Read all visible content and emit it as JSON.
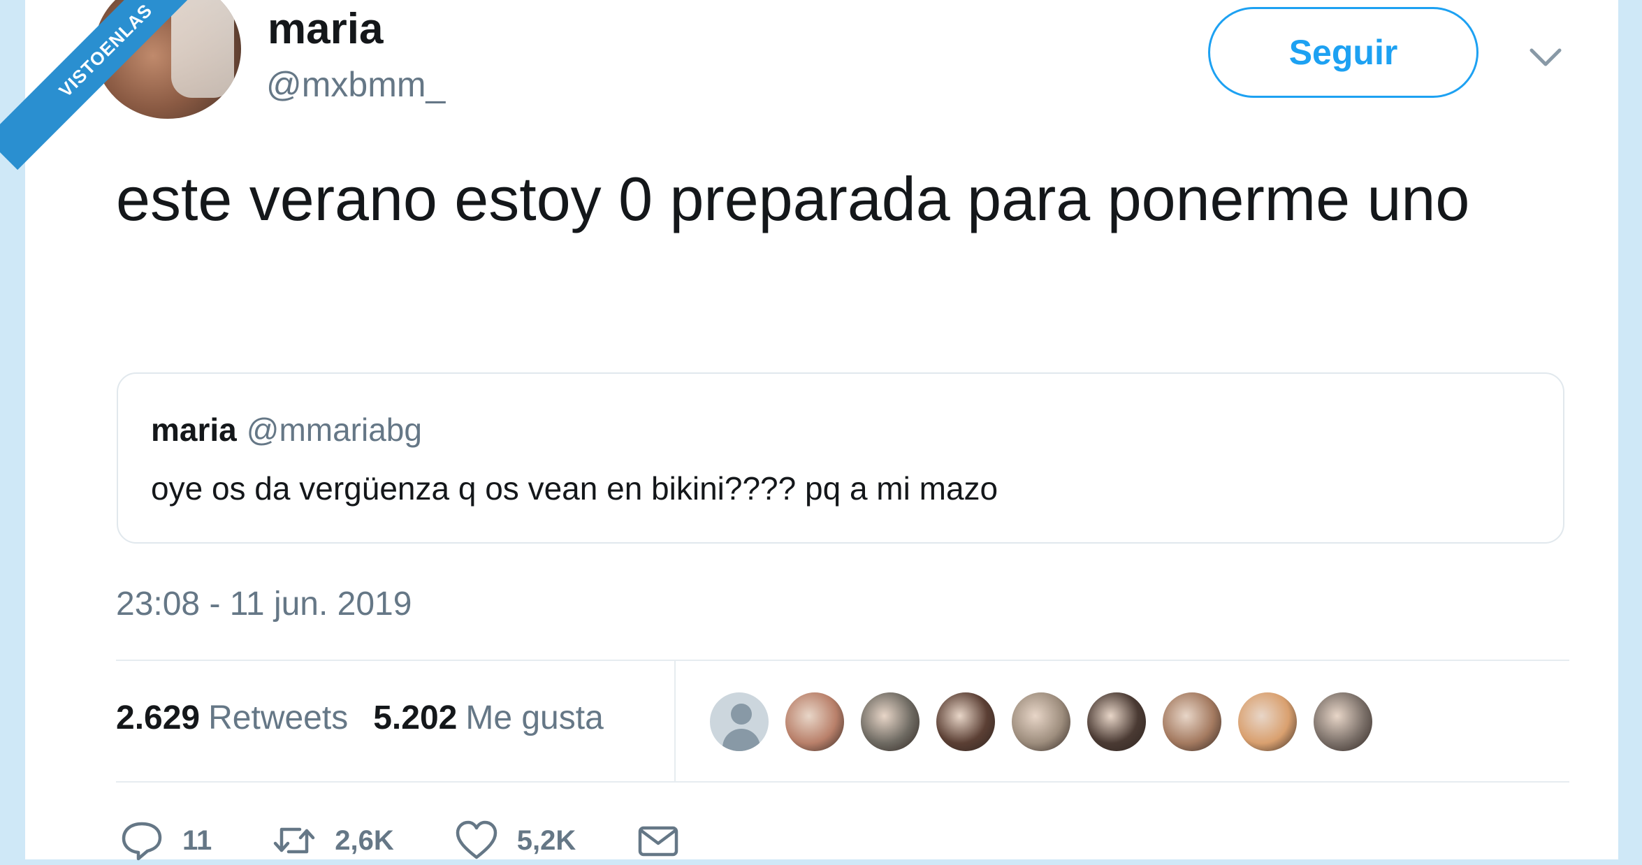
{
  "watermark": "VISTOENLAS",
  "tweet": {
    "author_name": "maria",
    "author_handle": "@mxbmm_",
    "follow_label": "Seguir",
    "text": "este verano estoy 0 preparada para ponerme uno",
    "timestamp": "23:08 - 11 jun. 2019"
  },
  "quoted": {
    "name": "maria",
    "handle": "@mmariabg",
    "text": "oye os da vergüenza q os vean en bikini???? pq a mi mazo"
  },
  "stats": {
    "retweets_count": "2.629",
    "retweets_label": "Retweets",
    "likes_count": "5.202",
    "likes_label": "Me gusta"
  },
  "likers": [
    {
      "color": "#ccd6dd",
      "kind": "default"
    },
    {
      "color": "#b9806a"
    },
    {
      "color": "#6e6a62"
    },
    {
      "color": "#5b3f34"
    },
    {
      "color": "#9d8d7d"
    },
    {
      "color": "#4a3a33"
    },
    {
      "color": "#a47a60"
    },
    {
      "color": "#d9a06f"
    },
    {
      "color": "#7a6f68"
    }
  ],
  "actions": {
    "reply_count": "11",
    "retweet_count": "2,6K",
    "like_count": "5,2K"
  },
  "icons": {
    "more": "chevron-down-icon",
    "reply": "reply-icon",
    "retweet": "retweet-icon",
    "like": "heart-icon",
    "message": "envelope-icon"
  },
  "colors": {
    "accent": "#1da1f2",
    "secondary_text": "#657786",
    "divider": "#e6ecf0",
    "ribbon": "#2a8fd0"
  }
}
